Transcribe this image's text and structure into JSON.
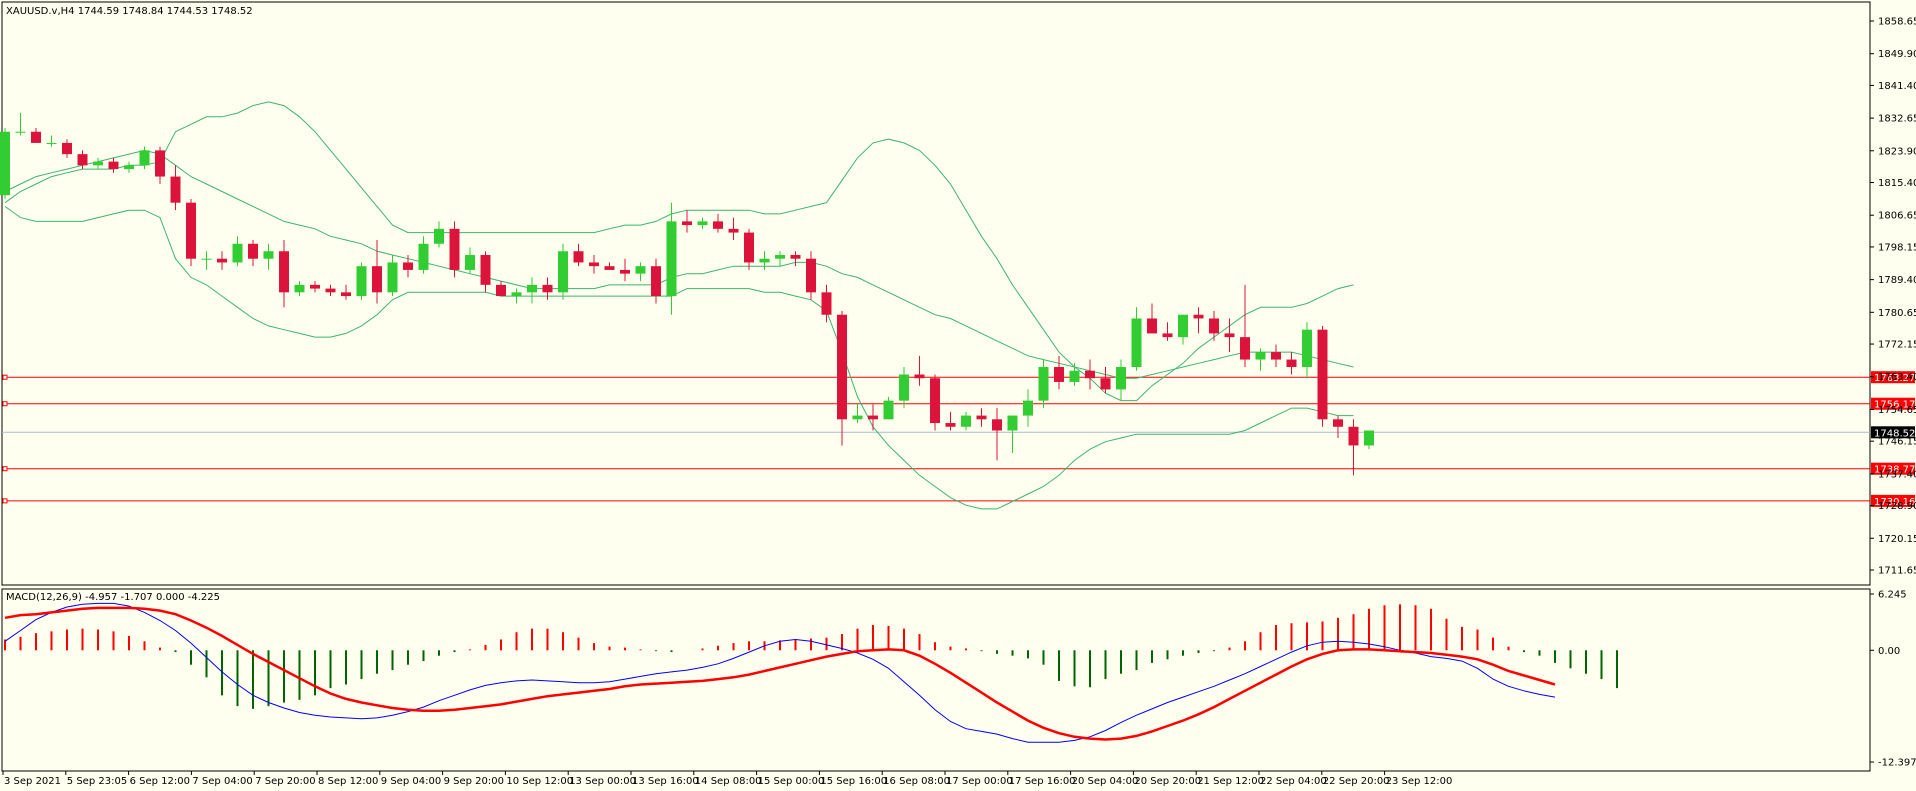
{
  "colors": {
    "background": "#fffff0",
    "bull_candle": "#32cd32",
    "bear_candle": "#dc143c",
    "bands": "#3cb371",
    "level_lines": "#ff0000",
    "price_line": "#a9bcd0",
    "macd_line": "#0000ff",
    "signal_line": "#ff0000",
    "hist_up": "#ff0000",
    "hist_down": "#006400",
    "price_tag": "#000000"
  },
  "chart_data": [
    {
      "type": "candlestick",
      "title": "XAUUSD.v,H4  1744.59 1748.84 1744.53 1748.52",
      "symbol": "XAUUSD.v",
      "timeframe": "H4",
      "ohlc_header": "1744.59 1748.84 1744.53 1748.52",
      "ylim": [
        1711.65,
        1858.65
      ],
      "y_tick_labels": [
        "1858.65",
        "1849.90",
        "1841.40",
        "1832.65",
        "1823.90",
        "1815.40",
        "1806.65",
        "1798.15",
        "1789.40",
        "1780.65",
        "1772.15",
        "1763.40",
        "1754.65",
        "1746.15",
        "1737.40",
        "1728.90",
        "1720.15",
        "1711.65"
      ],
      "x_tick_labels": [
        "3 Sep 2021",
        "5 Sep 23:05",
        "6 Sep 12:00",
        "7 Sep 04:00",
        "7 Sep 20:00",
        "8 Sep 12:00",
        "9 Sep 04:00",
        "9 Sep 20:00",
        "10 Sep 12:00",
        "13 Sep 00:00",
        "13 Sep 16:00",
        "14 Sep 08:00",
        "15 Sep 00:00",
        "15 Sep 16:00",
        "16 Sep 08:00",
        "17 Sep 00:00",
        "17 Sep 16:00",
        "20 Sep 04:00",
        "20 Sep 20:00",
        "21 Sep 12:00",
        "22 Sep 04:00",
        "22 Sep 20:00",
        "23 Sep 12:00"
      ],
      "level_lines": [
        "1763.27",
        "1756.17",
        "1738.77",
        "1730.16"
      ],
      "current_price": "1748.52",
      "candles": [
        [
          1812,
          1830,
          1811,
          1829
        ],
        [
          1829,
          1834,
          1828,
          1829
        ],
        [
          1829,
          1830,
          1826,
          1826
        ],
        [
          1826,
          1828,
          1825,
          1826
        ],
        [
          1826,
          1827,
          1822,
          1823
        ],
        [
          1823,
          1824,
          1819,
          1820
        ],
        [
          1820,
          1822,
          1819,
          1821
        ],
        [
          1821,
          1822,
          1818,
          1819
        ],
        [
          1819,
          1821,
          1818,
          1820
        ],
        [
          1820,
          1825,
          1819,
          1824
        ],
        [
          1824,
          1825,
          1815,
          1817
        ],
        [
          1817,
          1820,
          1808,
          1810
        ],
        [
          1810,
          1811,
          1793,
          1795
        ],
        [
          1795,
          1797,
          1792,
          1795
        ],
        [
          1795,
          1797,
          1792,
          1794
        ],
        [
          1794,
          1801,
          1793,
          1799
        ],
        [
          1799,
          1800,
          1793,
          1795
        ],
        [
          1795,
          1799,
          1792,
          1797
        ],
        [
          1797,
          1800,
          1782,
          1786
        ],
        [
          1786,
          1789,
          1785,
          1788
        ],
        [
          1788,
          1789,
          1786,
          1787
        ],
        [
          1787,
          1788,
          1785,
          1786
        ],
        [
          1786,
          1788,
          1784,
          1785
        ],
        [
          1785,
          1794,
          1784,
          1793
        ],
        [
          1793,
          1800,
          1783,
          1786
        ],
        [
          1786,
          1796,
          1785,
          1794
        ],
        [
          1794,
          1796,
          1790,
          1792
        ],
        [
          1792,
          1801,
          1791,
          1799
        ],
        [
          1799,
          1805,
          1798,
          1803
        ],
        [
          1803,
          1805,
          1790,
          1792
        ],
        [
          1792,
          1798,
          1791,
          1796
        ],
        [
          1796,
          1797,
          1786,
          1788
        ],
        [
          1788,
          1789,
          1785,
          1785
        ],
        [
          1785,
          1787,
          1783,
          1786
        ],
        [
          1786,
          1790,
          1783,
          1788
        ],
        [
          1788,
          1790,
          1784,
          1786
        ],
        [
          1786,
          1799,
          1784,
          1797
        ],
        [
          1797,
          1799,
          1793,
          1794
        ],
        [
          1794,
          1796,
          1791,
          1793
        ],
        [
          1793,
          1794,
          1792,
          1792
        ],
        [
          1792,
          1795,
          1789,
          1791
        ],
        [
          1791,
          1794,
          1789,
          1793
        ],
        [
          1793,
          1795,
          1783,
          1785
        ],
        [
          1785,
          1810,
          1780,
          1805
        ],
        [
          1805,
          1808,
          1802,
          1804
        ],
        [
          1804,
          1806,
          1803,
          1805
        ],
        [
          1805,
          1807,
          1802,
          1803
        ],
        [
          1803,
          1806,
          1800,
          1802
        ],
        [
          1802,
          1803,
          1792,
          1794
        ],
        [
          1794,
          1797,
          1792,
          1795
        ],
        [
          1795,
          1797,
          1793,
          1796
        ],
        [
          1796,
          1797,
          1793,
          1795
        ],
        [
          1795,
          1797,
          1784,
          1786
        ],
        [
          1786,
          1788,
          1778,
          1780
        ],
        [
          1780,
          1781,
          1745,
          1752
        ],
        [
          1752,
          1756,
          1751,
          1753
        ],
        [
          1753,
          1756,
          1749,
          1752
        ],
        [
          1752,
          1758,
          1752,
          1757
        ],
        [
          1757,
          1766,
          1755,
          1764
        ],
        [
          1764,
          1769,
          1761,
          1763
        ],
        [
          1763,
          1764,
          1749,
          1751
        ],
        [
          1751,
          1754,
          1749,
          1750
        ],
        [
          1750,
          1754,
          1749,
          1753
        ],
        [
          1753,
          1755,
          1750,
          1752
        ],
        [
          1752,
          1755,
          1741,
          1749
        ],
        [
          1749,
          1752,
          1743,
          1753
        ],
        [
          1753,
          1760,
          1750,
          1757
        ],
        [
          1757,
          1768,
          1755,
          1766
        ],
        [
          1766,
          1769,
          1760,
          1762
        ],
        [
          1762,
          1767,
          1761,
          1765
        ],
        [
          1765,
          1768,
          1760,
          1763
        ],
        [
          1763,
          1766,
          1759,
          1760
        ],
        [
          1760,
          1768,
          1757,
          1766
        ],
        [
          1766,
          1782,
          1765,
          1779
        ],
        [
          1779,
          1783,
          1775,
          1775
        ],
        [
          1775,
          1778,
          1773,
          1774
        ],
        [
          1774,
          1780,
          1772,
          1780
        ],
        [
          1780,
          1782,
          1775,
          1779
        ],
        [
          1779,
          1781,
          1773,
          1775
        ],
        [
          1775,
          1779,
          1770,
          1774
        ],
        [
          1774,
          1788,
          1766,
          1768
        ],
        [
          1768,
          1771,
          1765,
          1770
        ],
        [
          1770,
          1772,
          1766,
          1768
        ],
        [
          1768,
          1770,
          1764,
          1766
        ],
        [
          1766,
          1778,
          1763,
          1776
        ],
        [
          1776,
          1777,
          1750,
          1752
        ],
        [
          1752,
          1753,
          1747,
          1750
        ],
        [
          1750,
          1752,
          1737,
          1745
        ],
        [
          1745,
          1749,
          1744,
          1749
        ]
      ],
      "upper_band": [
        1810,
        1813,
        1815,
        1817,
        1818,
        1819,
        1819,
        1819,
        1820,
        1820,
        1821,
        1829,
        1831,
        1833,
        1833,
        1834,
        1836,
        1837,
        1836,
        1833,
        1829,
        1824,
        1819,
        1814,
        1809,
        1804,
        1802,
        1802,
        1802,
        1802,
        1802,
        1802,
        1802,
        1802,
        1802,
        1802,
        1802,
        1802,
        1802,
        1803,
        1804,
        1804,
        1805,
        1807,
        1808,
        1808,
        1808,
        1808,
        1808,
        1807,
        1807,
        1808,
        1809,
        1810,
        1816,
        1822,
        1826,
        1827,
        1826,
        1824,
        1820,
        1815,
        1808,
        1801,
        1795,
        1788,
        1782,
        1776,
        1770,
        1766,
        1763,
        1759,
        1757,
        1757,
        1761,
        1764,
        1767,
        1771,
        1774,
        1777,
        1780,
        1782,
        1782,
        1782,
        1783,
        1785,
        1787,
        1788
      ],
      "middle_band": [
        1813,
        1815,
        1817,
        1818,
        1819,
        1820,
        1821,
        1822,
        1823,
        1824,
        1823,
        1820,
        1817,
        1815,
        1813,
        1811,
        1809,
        1807,
        1805,
        1804,
        1803,
        1801,
        1800,
        1799,
        1797,
        1796,
        1795,
        1794,
        1793,
        1792,
        1791,
        1790,
        1789,
        1788,
        1787,
        1787,
        1787,
        1787,
        1787,
        1788,
        1788,
        1788,
        1788,
        1790,
        1791,
        1791,
        1792,
        1793,
        1793,
        1793,
        1793,
        1794,
        1794,
        1793,
        1791,
        1790,
        1788,
        1786,
        1784,
        1782,
        1780,
        1779,
        1777,
        1775,
        1773,
        1771,
        1769,
        1768,
        1767,
        1766,
        1765,
        1764,
        1763,
        1763,
        1764,
        1765,
        1766,
        1767,
        1768,
        1769,
        1770,
        1770,
        1770,
        1770,
        1769,
        1768,
        1767,
        1766
      ],
      "lower_band": [
        1809,
        1806,
        1805,
        1805,
        1805,
        1805,
        1806,
        1807,
        1808,
        1808,
        1806,
        1795,
        1790,
        1788,
        1785,
        1782,
        1779,
        1777,
        1776,
        1775,
        1774,
        1774,
        1775,
        1777,
        1780,
        1784,
        1786,
        1786,
        1786,
        1786,
        1786,
        1786,
        1785,
        1785,
        1785,
        1785,
        1785,
        1785,
        1785,
        1785,
        1785,
        1785,
        1785,
        1785,
        1787,
        1787,
        1787,
        1787,
        1787,
        1786,
        1786,
        1785,
        1784,
        1781,
        1770,
        1758,
        1750,
        1745,
        1741,
        1737,
        1734,
        1731,
        1729,
        1728,
        1728,
        1730,
        1732,
        1734,
        1737,
        1741,
        1744,
        1746,
        1747,
        1748,
        1748,
        1748,
        1748,
        1748,
        1748,
        1748,
        1749,
        1751,
        1753,
        1755,
        1755,
        1754,
        1753,
        1753
      ]
    },
    {
      "type": "macd",
      "title": "MACD(12,26,9) -4.957 -1.707 0.000 -4.225",
      "ylim": [
        -12.397,
        6.245
      ],
      "y_tick_labels": [
        "6.245",
        "0.00",
        "-12.397"
      ],
      "histogram": [
        1.2,
        1.5,
        1.9,
        2.1,
        2.3,
        2.4,
        2.3,
        2.1,
        1.6,
        1.0,
        0.3,
        -0.2,
        -1.6,
        -3.0,
        -5.0,
        -6.2,
        -6.5,
        -6.2,
        -5.8,
        -5.5,
        -5.0,
        -4.2,
        -3.8,
        -3.2,
        -2.6,
        -2.2,
        -1.6,
        -1.2,
        -0.6,
        -0.2,
        0.1,
        0.6,
        1.2,
        2.0,
        2.4,
        2.4,
        2.0,
        1.4,
        0.8,
        0.4,
        0.3,
        0.1,
        -0.1,
        -0.2,
        0.0,
        0.2,
        0.5,
        0.8,
        1.0,
        1.0,
        1.1,
        1.2,
        1.3,
        1.4,
        1.8,
        2.4,
        2.8,
        2.7,
        2.4,
        1.8,
        0.9,
        0.4,
        0.2,
        -0.1,
        -0.4,
        -0.6,
        -0.9,
        -1.6,
        -3.4,
        -4.0,
        -4.1,
        -3.2,
        -2.6,
        -2.2,
        -1.4,
        -1.0,
        -0.6,
        -0.3,
        -0.1,
        0.3,
        1.0,
        2.0,
        2.8,
        3.0,
        3.1,
        3.2,
        3.6,
        4.0,
        4.6,
        5.0,
        5.1,
        5.0,
        4.6,
        3.5,
        2.6,
        2.3,
        1.4,
        0.4,
        -0.2,
        -0.6,
        -1.4,
        -2.0,
        -2.6,
        -3.2,
        -4.2
      ],
      "macd": [
        1.0,
        2.2,
        3.4,
        4.2,
        4.8,
        5.1,
        5.2,
        5.2,
        4.9,
        4.2,
        3.3,
        2.2,
        0.8,
        -0.8,
        -2.4,
        -3.8,
        -5.0,
        -5.8,
        -6.4,
        -6.9,
        -7.2,
        -7.4,
        -7.5,
        -7.6,
        -7.5,
        -7.2,
        -6.8,
        -6.3,
        -5.6,
        -5.0,
        -4.4,
        -3.9,
        -3.6,
        -3.4,
        -3.3,
        -3.4,
        -3.5,
        -3.6,
        -3.6,
        -3.5,
        -3.2,
        -2.9,
        -2.6,
        -2.4,
        -2.2,
        -1.9,
        -1.5,
        -0.9,
        -0.2,
        0.5,
        1.0,
        1.2,
        1.0,
        0.6,
        0.2,
        -0.3,
        -1.0,
        -2.0,
        -3.5,
        -5.0,
        -6.6,
        -7.9,
        -8.7,
        -9.0,
        -9.3,
        -9.8,
        -10.2,
        -10.2,
        -10.2,
        -10.0,
        -9.6,
        -8.9,
        -8.0,
        -7.2,
        -6.5,
        -5.8,
        -5.2,
        -4.6,
        -4.0,
        -3.3,
        -2.6,
        -1.8,
        -1.0,
        -0.2,
        0.5,
        0.9,
        1.0,
        0.9,
        0.7,
        0.4,
        0.0,
        -0.3,
        -0.7,
        -0.9,
        -1.2,
        -2.0,
        -3.2,
        -4.0,
        -4.5,
        -4.9,
        -5.2
      ],
      "signal": [
        3.6,
        3.9,
        4.0,
        4.2,
        4.4,
        4.6,
        4.7,
        4.7,
        4.7,
        4.6,
        4.4,
        4.0,
        3.3,
        2.5,
        1.6,
        0.6,
        -0.4,
        -1.3,
        -2.2,
        -3.1,
        -4.0,
        -4.8,
        -5.4,
        -5.8,
        -6.1,
        -6.4,
        -6.6,
        -6.7,
        -6.7,
        -6.6,
        -6.4,
        -6.2,
        -6.0,
        -5.7,
        -5.4,
        -5.1,
        -4.9,
        -4.7,
        -4.5,
        -4.3,
        -4.0,
        -3.8,
        -3.7,
        -3.6,
        -3.5,
        -3.4,
        -3.2,
        -3.0,
        -2.7,
        -2.3,
        -1.9,
        -1.5,
        -1.1,
        -0.7,
        -0.4,
        -0.1,
        0.0,
        0.1,
        0.0,
        -0.6,
        -1.5,
        -2.5,
        -3.6,
        -4.7,
        -5.8,
        -6.8,
        -7.8,
        -8.6,
        -9.2,
        -9.6,
        -9.8,
        -9.9,
        -9.8,
        -9.5,
        -9.0,
        -8.4,
        -7.8,
        -7.1,
        -6.3,
        -5.4,
        -4.5,
        -3.6,
        -2.7,
        -1.8,
        -1.0,
        -0.4,
        0.0,
        0.1,
        0.1,
        0.0,
        -0.1,
        -0.2,
        -0.3,
        -0.5,
        -0.7,
        -1.0,
        -1.6,
        -2.3,
        -2.8,
        -3.3,
        -3.8
      ]
    }
  ]
}
